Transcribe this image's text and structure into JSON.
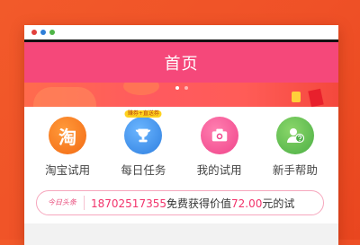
{
  "header": {
    "title": "首页"
  },
  "banner": {
    "pages": 2,
    "active_page": 1
  },
  "shortcuts": [
    {
      "label": "淘宝试用",
      "icon": "taobao-icon",
      "glyph": "淘",
      "color": "#f37a1f"
    },
    {
      "label": "每日任务",
      "icon": "trophy-icon",
      "badge": "赚券+直送券",
      "color": "#3b8ff0"
    },
    {
      "label": "我的试用",
      "icon": "camera-icon",
      "color": "#f2508f"
    },
    {
      "label": "新手帮助",
      "icon": "help-person-icon",
      "color": "#5cbd4f"
    }
  ],
  "ticker": {
    "tag": "今日头条",
    "phone": "18702517355",
    "text1": "免费获得价值",
    "amount": "72.00",
    "text2": "元的试"
  },
  "colors": {
    "header": "#f5487a",
    "background": "#ef5127",
    "highlight": "#f2336b"
  }
}
